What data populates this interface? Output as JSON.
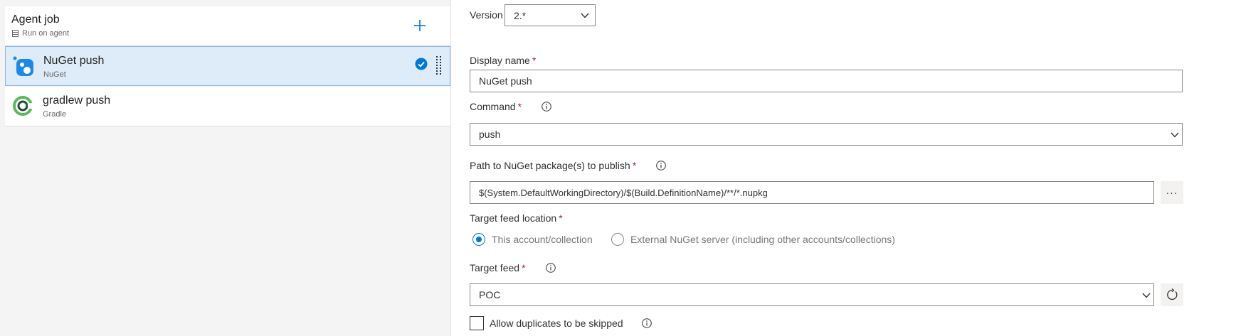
{
  "left": {
    "job": {
      "title": "Agent job",
      "subtitle": "Run on agent"
    },
    "tasks": [
      {
        "title": "NuGet push",
        "subtitle": "NuGet"
      },
      {
        "title": "gradlew push",
        "subtitle": "Gradle"
      }
    ]
  },
  "form": {
    "version": {
      "label": "Version",
      "value": "2.*"
    },
    "display_name": {
      "label": "Display name",
      "required": "*",
      "value": "NuGet push"
    },
    "command": {
      "label": "Command",
      "required": "*",
      "value": "push"
    },
    "path": {
      "label": "Path to NuGet package(s) to publish",
      "required": "*",
      "value": "$(System.DefaultWorkingDirectory)/$(Build.DefinitionName)/**/*.nupkg",
      "browse": "···"
    },
    "target_location": {
      "label": "Target feed location",
      "required": "*",
      "options": [
        "This account/collection",
        "External NuGet server (including other accounts/collections)"
      ],
      "selected": "This account/collection"
    },
    "target_feed": {
      "label": "Target feed",
      "required": "*",
      "value": "POC"
    },
    "allow_duplicates": {
      "label": "Allow duplicates to be skipped",
      "checked": false
    }
  },
  "colors": {
    "accent": "#0078d4",
    "required": "#a4262c",
    "selected_bg": "#deecf9"
  }
}
